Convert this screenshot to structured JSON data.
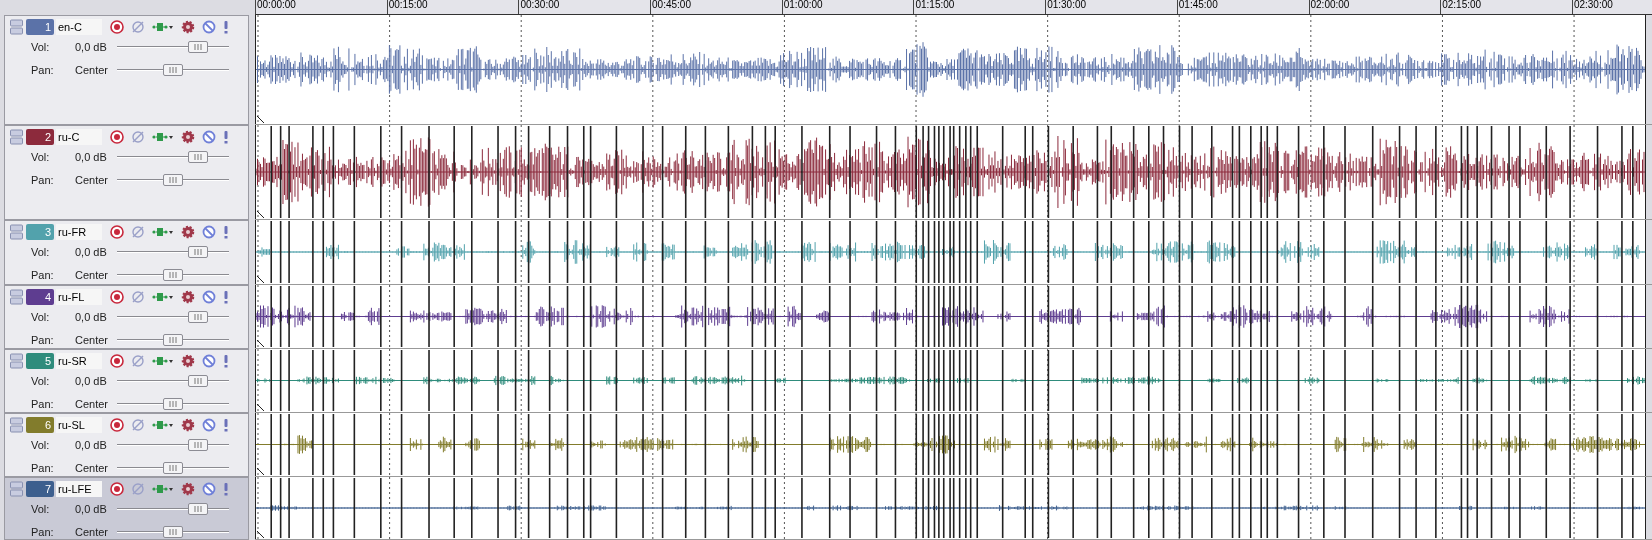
{
  "ruler": {
    "labels": [
      "00:00:00",
      "00:15:00",
      "00:30:00",
      "00:45:00",
      "01:00:00",
      "01:15:00",
      "01:30:00",
      "01:45:00",
      "02:00:00",
      "02:15:00",
      "02:30:00"
    ]
  },
  "tracks": [
    {
      "number": "1",
      "name": "en-C",
      "color": "#5b72a8",
      "vol": {
        "label": "Vol:",
        "reading": "0,0 dB",
        "level": 0.72
      },
      "pan": {
        "label": "Pan:",
        "reading": "Center",
        "level": 0.5
      },
      "selected": false
    },
    {
      "number": "2",
      "name": "ru-C",
      "color": "#8c2a3c",
      "vol": {
        "label": "Vol:",
        "reading": "0,0 dB",
        "level": 0.72
      },
      "pan": {
        "label": "Pan:",
        "reading": "Center",
        "level": 0.5
      },
      "selected": false
    },
    {
      "number": "3",
      "name": "ru-FR",
      "color": "#52a2ac",
      "vol": {
        "label": "Vol:",
        "reading": "0,0 dB",
        "level": 0.72
      },
      "pan": {
        "label": "Pan:",
        "reading": "Center",
        "level": 0.5
      },
      "selected": false
    },
    {
      "number": "4",
      "name": "ru-FL",
      "color": "#5e3d90",
      "vol": {
        "label": "Vol:",
        "reading": "0,0 dB",
        "level": 0.72
      },
      "pan": {
        "label": "Pan:",
        "reading": "Center",
        "level": 0.5
      },
      "selected": false
    },
    {
      "number": "5",
      "name": "ru-SR",
      "color": "#2f8c7c",
      "vol": {
        "label": "Vol:",
        "reading": "0,0 dB",
        "level": 0.72
      },
      "pan": {
        "label": "Pan:",
        "reading": "Center",
        "level": 0.5
      },
      "selected": false
    },
    {
      "number": "6",
      "name": "ru-SL",
      "color": "#827c2c",
      "vol": {
        "label": "Vol:",
        "reading": "0,0 dB",
        "level": 0.72
      },
      "pan": {
        "label": "Pan:",
        "reading": "Center",
        "level": 0.5
      },
      "selected": false
    },
    {
      "number": "7",
      "name": "ru-LFE",
      "color": "#3d5f8e",
      "vol": {
        "label": "Vol:",
        "reading": "0,0 dB",
        "level": 0.72
      },
      "pan": {
        "label": "Pan:",
        "reading": "Center",
        "level": 0.5
      },
      "selected": true
    }
  ]
}
